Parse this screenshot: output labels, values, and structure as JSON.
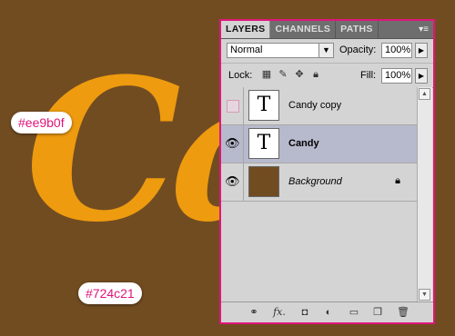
{
  "canvas": {
    "text": "Ca",
    "text_color": "#ee9b0f",
    "background_color": "#724c21"
  },
  "annotations": {
    "orange_label": "#ee9b0f",
    "brown_label": "#724c21"
  },
  "panel": {
    "tabs": [
      {
        "label": "LAYERS",
        "active": true
      },
      {
        "label": "CHANNELS",
        "active": false
      },
      {
        "label": "PATHS",
        "active": false
      }
    ],
    "menu_icon": "panel-menu-icon",
    "blend_mode": "Normal",
    "opacity_label": "Opacity:",
    "opacity_value": "100%",
    "lock_label": "Lock:",
    "fill_label": "Fill:",
    "fill_value": "100%",
    "lock_icons": [
      "lock-transparent-icon",
      "lock-image-icon",
      "lock-position-icon",
      "lock-all-icon"
    ],
    "layers": [
      {
        "name": "Candy copy",
        "visible": false,
        "type": "text",
        "selected": false
      },
      {
        "name": "Candy",
        "visible": true,
        "type": "text",
        "selected": true
      },
      {
        "name": "Background",
        "visible": true,
        "type": "fill",
        "selected": false,
        "locked": true
      }
    ],
    "thumb_text_glyph": "T",
    "bottom_icons": [
      "link-layers-icon",
      "layer-style-fx-icon",
      "layer-mask-icon",
      "adjustment-layer-icon",
      "new-group-icon",
      "new-layer-icon",
      "trash-icon"
    ]
  }
}
